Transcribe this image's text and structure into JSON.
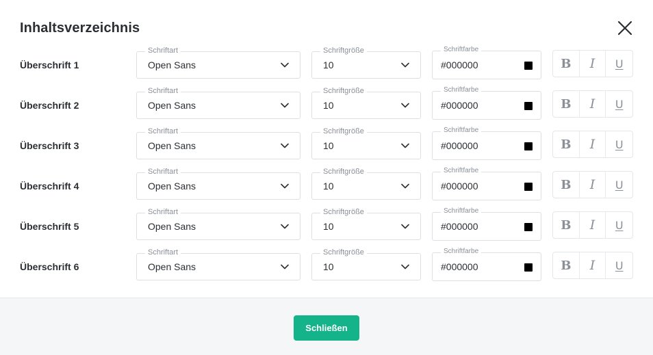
{
  "dialog": {
    "title": "Inhaltsverzeichnis",
    "close_action_label": "Schließen"
  },
  "field_labels": {
    "font": "Schriftart",
    "size": "Schriftgröße",
    "color": "Schriftfarbe"
  },
  "format_buttons": {
    "bold": "B",
    "italic": "I",
    "underline": "U"
  },
  "colors": {
    "accent": "#14b38a",
    "swatch": "#000000"
  },
  "rows": [
    {
      "label": "Überschrift 1",
      "font": "Open Sans",
      "size": "10",
      "color": "#000000"
    },
    {
      "label": "Überschrift 2",
      "font": "Open Sans",
      "size": "10",
      "color": "#000000"
    },
    {
      "label": "Überschrift 3",
      "font": "Open Sans",
      "size": "10",
      "color": "#000000"
    },
    {
      "label": "Überschrift 4",
      "font": "Open Sans",
      "size": "10",
      "color": "#000000"
    },
    {
      "label": "Überschrift 5",
      "font": "Open Sans",
      "size": "10",
      "color": "#000000"
    },
    {
      "label": "Überschrift 6",
      "font": "Open Sans",
      "size": "10",
      "color": "#000000"
    }
  ]
}
